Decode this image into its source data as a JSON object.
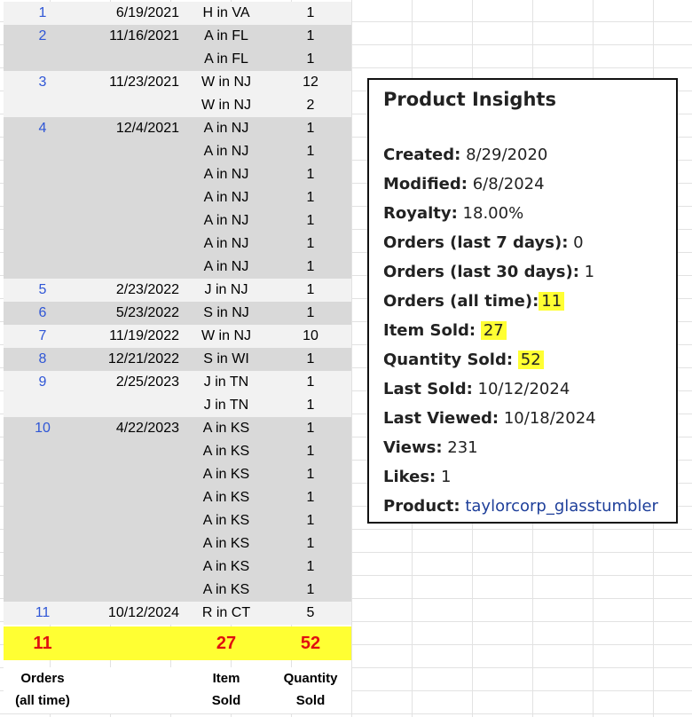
{
  "rows": [
    {
      "num": "1",
      "date": "6/19/2021",
      "loc": "H in VA",
      "qty": "1",
      "shade": "light"
    },
    {
      "num": "2",
      "date": "11/16/2021",
      "loc": "A in FL",
      "qty": "1",
      "shade": "dark"
    },
    {
      "num": "",
      "date": "",
      "loc": "A in FL",
      "qty": "1",
      "shade": "dark"
    },
    {
      "num": "3",
      "date": "11/23/2021",
      "loc": "W in NJ",
      "qty": "12",
      "shade": "light"
    },
    {
      "num": "",
      "date": "",
      "loc": "W in NJ",
      "qty": "2",
      "shade": "light"
    },
    {
      "num": "4",
      "date": "12/4/2021",
      "loc": "A in NJ",
      "qty": "1",
      "shade": "dark"
    },
    {
      "num": "",
      "date": "",
      "loc": "A in NJ",
      "qty": "1",
      "shade": "dark"
    },
    {
      "num": "",
      "date": "",
      "loc": "A in NJ",
      "qty": "1",
      "shade": "dark"
    },
    {
      "num": "",
      "date": "",
      "loc": "A in NJ",
      "qty": "1",
      "shade": "dark"
    },
    {
      "num": "",
      "date": "",
      "loc": "A in NJ",
      "qty": "1",
      "shade": "dark"
    },
    {
      "num": "",
      "date": "",
      "loc": "A in NJ",
      "qty": "1",
      "shade": "dark"
    },
    {
      "num": "",
      "date": "",
      "loc": "A in NJ",
      "qty": "1",
      "shade": "dark"
    },
    {
      "num": "5",
      "date": "2/23/2022",
      "loc": "J in NJ",
      "qty": "1",
      "shade": "light"
    },
    {
      "num": "6",
      "date": "5/23/2022",
      "loc": "S in NJ",
      "qty": "1",
      "shade": "dark"
    },
    {
      "num": "7",
      "date": "11/19/2022",
      "loc": "W in NJ",
      "qty": "10",
      "shade": "light"
    },
    {
      "num": "8",
      "date": "12/21/2022",
      "loc": "S in WI",
      "qty": "1",
      "shade": "dark"
    },
    {
      "num": "9",
      "date": "2/25/2023",
      "loc": "J in TN",
      "qty": "1",
      "shade": "light"
    },
    {
      "num": "",
      "date": "",
      "loc": "J in TN",
      "qty": "1",
      "shade": "light"
    },
    {
      "num": "10",
      "date": "4/22/2023",
      "loc": "A in KS",
      "qty": "1",
      "shade": "dark"
    },
    {
      "num": "",
      "date": "",
      "loc": "A in KS",
      "qty": "1",
      "shade": "dark"
    },
    {
      "num": "",
      "date": "",
      "loc": "A in KS",
      "qty": "1",
      "shade": "dark"
    },
    {
      "num": "",
      "date": "",
      "loc": "A in KS",
      "qty": "1",
      "shade": "dark"
    },
    {
      "num": "",
      "date": "",
      "loc": "A in KS",
      "qty": "1",
      "shade": "dark"
    },
    {
      "num": "",
      "date": "",
      "loc": "A in KS",
      "qty": "1",
      "shade": "dark"
    },
    {
      "num": "",
      "date": "",
      "loc": "A in KS",
      "qty": "1",
      "shade": "dark"
    },
    {
      "num": "",
      "date": "",
      "loc": "A in KS",
      "qty": "1",
      "shade": "dark"
    },
    {
      "num": "11",
      "date": "10/12/2024",
      "loc": "R in CT",
      "qty": "5",
      "shade": "light"
    }
  ],
  "totals": {
    "orders": "11",
    "items": "27",
    "quantity": "52"
  },
  "footer": {
    "orders_line1": "Orders",
    "orders_line2": "(all time)",
    "items_line1": "Item",
    "items_line2": "Sold",
    "quantity_line1": "Quantity",
    "quantity_line2": "Sold"
  },
  "insights": {
    "title": "Product Insights",
    "created_label": "Created:",
    "created_value": "8/29/2020",
    "modified_label": "Modified:",
    "modified_value": "6/8/2024",
    "royalty_label": "Royalty:",
    "royalty_value": "18.00%",
    "orders7_label": "Orders (last 7 days):",
    "orders7_value": "0",
    "orders30_label": "Orders (last 30 days):",
    "orders30_value": "1",
    "ordersall_label": "Orders (all time):",
    "ordersall_value": "11",
    "itemsold_label": "Item Sold:",
    "itemsold_value": "27",
    "qtysold_label": "Quantity Sold:",
    "qtysold_value": "52",
    "lastsold_label": "Last Sold:",
    "lastsold_value": "10/12/2024",
    "lastviewed_label": "Last Viewed:",
    "lastviewed_value": "10/18/2024",
    "views_label": "Views:",
    "views_value": "231",
    "likes_label": "Likes:",
    "likes_value": "1",
    "product_label": "Product:",
    "product_value": "taylorcorp_glasstumbler"
  },
  "colors": {
    "row_dark": "#d9d9d9",
    "row_light": "#f2f2f2",
    "highlight": "#ffff33",
    "totals_text": "#e01010",
    "order_num": "#2f56d6",
    "product_link": "#1e3f9a"
  }
}
